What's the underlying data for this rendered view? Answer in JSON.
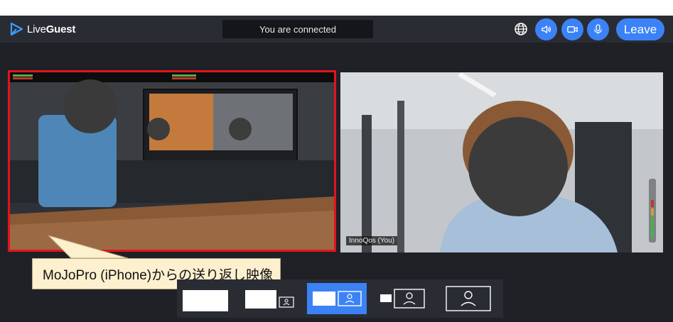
{
  "header": {
    "logo_prefix": "Live",
    "logo_bold": "Guest",
    "status": "You are connected",
    "leave_label": "Leave"
  },
  "controls": {
    "globe_icon": "globe-icon",
    "speaker_icon": "speaker-icon",
    "camera_icon": "camera-icon",
    "mic_icon": "mic-icon",
    "accent": "#3b82f6"
  },
  "tiles": {
    "left": {
      "highlight_color": "#e3141b"
    },
    "right": {
      "name": "InnoQos (You)"
    }
  },
  "callout": {
    "text": "MoJoPro (iPhone)からの送り返し映像"
  },
  "layout_options": {
    "active_index": 2,
    "count": 5
  }
}
